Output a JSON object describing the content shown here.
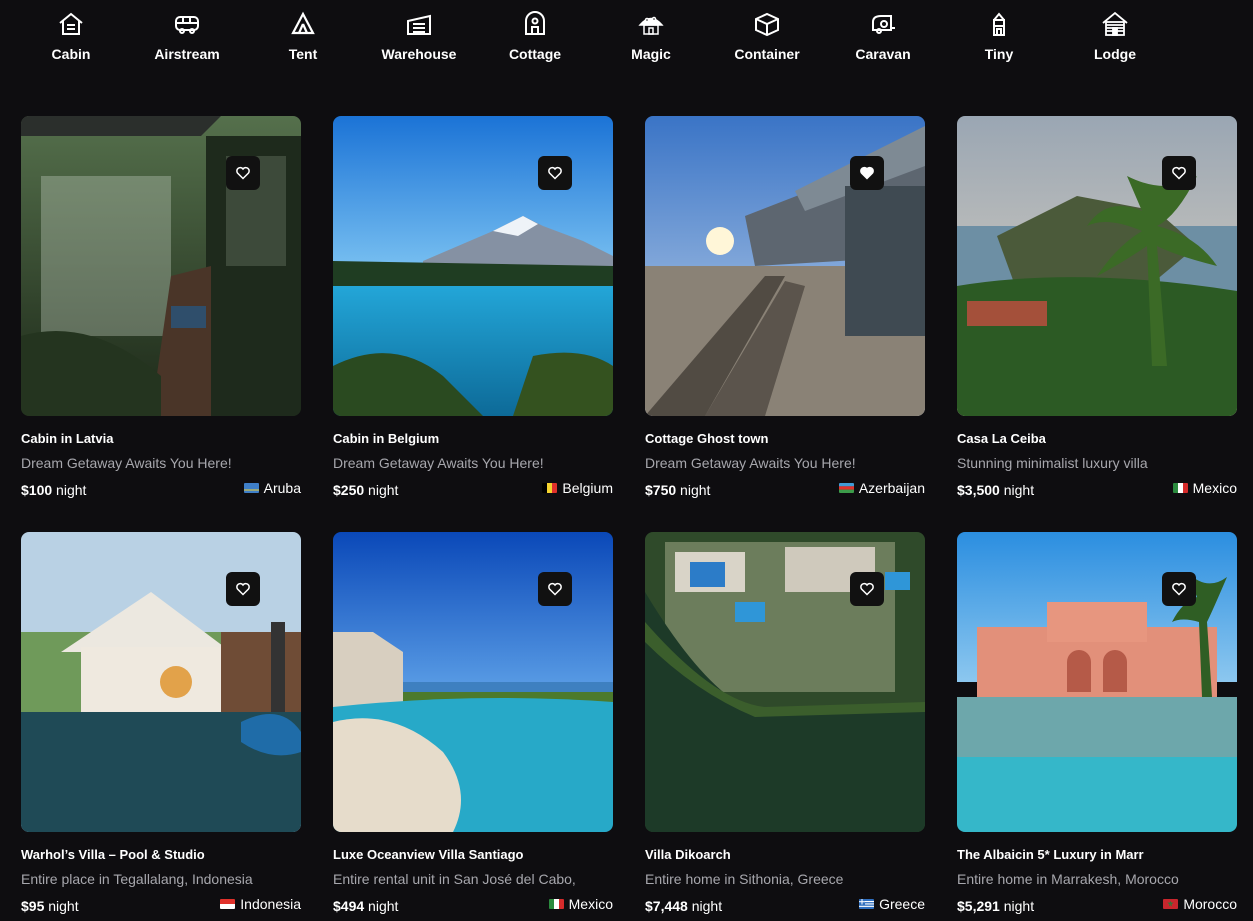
{
  "categories": [
    {
      "label": "Cabin",
      "icon": "cabin-icon"
    },
    {
      "label": "Airstream",
      "icon": "airstream-icon"
    },
    {
      "label": "Tent",
      "icon": "tent-icon"
    },
    {
      "label": "Warehouse",
      "icon": "warehouse-icon"
    },
    {
      "label": "Cottage",
      "icon": "cottage-icon"
    },
    {
      "label": "Magic",
      "icon": "magic-icon"
    },
    {
      "label": "Container",
      "icon": "container-icon"
    },
    {
      "label": "Caravan",
      "icon": "caravan-icon"
    },
    {
      "label": "Tiny",
      "icon": "tiny-icon"
    },
    {
      "label": "Lodge",
      "icon": "lodge-icon"
    }
  ],
  "listings": [
    {
      "title": "Cabin in Latvia",
      "subtitle": "Dream Getaway Awaits You Here!",
      "price": "$100",
      "unit": "night",
      "country": "Aruba",
      "favorited": false,
      "scene": "forest balcony"
    },
    {
      "title": "Cabin in Belgium",
      "subtitle": "Dream Getaway Awaits You Here!",
      "price": "$250",
      "unit": "night",
      "country": "Belgium",
      "favorited": false,
      "scene": "mountain lake"
    },
    {
      "title": "Cottage Ghost town",
      "subtitle": "Dream Getaway Awaits You Here!",
      "price": "$750",
      "unit": "night",
      "country": "Azerbaijan",
      "favorited": true,
      "scene": "general store at sunset"
    },
    {
      "title": "Casa La Ceiba",
      "subtitle": "Stunning minimalist luxury villa",
      "price": "$3,500",
      "unit": "night",
      "country": "Mexico",
      "favorited": false,
      "scene": "coastal cliffs with palm"
    },
    {
      "title": "Warhol’s Villa – Pool & Studio",
      "subtitle": "Entire place in Tegallalang, Indonesia",
      "price": "$95",
      "unit": "night",
      "country": "Indonesia",
      "favorited": false,
      "scene": "villa with pool"
    },
    {
      "title": "Luxe Oceanview Villa Santiago",
      "subtitle": "Entire rental unit in San José del Cabo,",
      "price": "$494",
      "unit": "night",
      "country": "Mexico",
      "favorited": false,
      "scene": "infinity pool ocean"
    },
    {
      "title": "Villa Dikoarch",
      "subtitle": "Entire home in Sithonia, Greece",
      "price": "$7,448",
      "unit": "night",
      "country": "Greece",
      "favorited": false,
      "scene": "aerial villa by water"
    },
    {
      "title": "The Albaicin 5* Luxury in Marr",
      "subtitle": "Entire home in Marrakesh, Morocco",
      "price": "$5,291",
      "unit": "night",
      "country": "Morocco",
      "favorited": false,
      "scene": "pink riad pool"
    }
  ]
}
